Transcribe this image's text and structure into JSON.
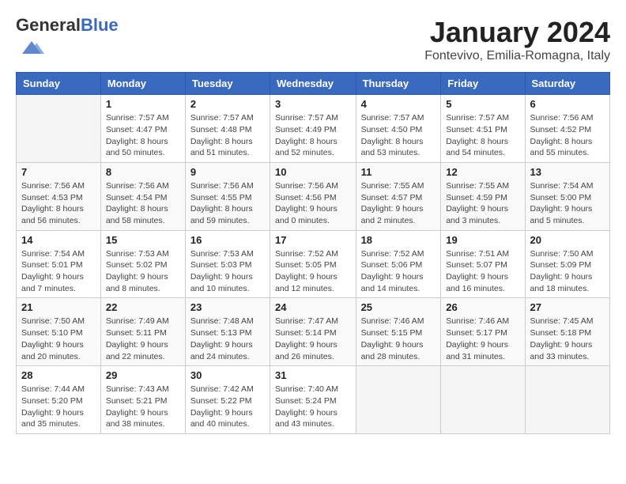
{
  "header": {
    "logo_general": "General",
    "logo_blue": "Blue",
    "month_title": "January 2024",
    "location": "Fontevivo, Emilia-Romagna, Italy"
  },
  "weekdays": [
    "Sunday",
    "Monday",
    "Tuesday",
    "Wednesday",
    "Thursday",
    "Friday",
    "Saturday"
  ],
  "weeks": [
    [
      {
        "day": "",
        "sunrise": "",
        "sunset": "",
        "daylight": ""
      },
      {
        "day": "1",
        "sunrise": "Sunrise: 7:57 AM",
        "sunset": "Sunset: 4:47 PM",
        "daylight": "Daylight: 8 hours and 50 minutes."
      },
      {
        "day": "2",
        "sunrise": "Sunrise: 7:57 AM",
        "sunset": "Sunset: 4:48 PM",
        "daylight": "Daylight: 8 hours and 51 minutes."
      },
      {
        "day": "3",
        "sunrise": "Sunrise: 7:57 AM",
        "sunset": "Sunset: 4:49 PM",
        "daylight": "Daylight: 8 hours and 52 minutes."
      },
      {
        "day": "4",
        "sunrise": "Sunrise: 7:57 AM",
        "sunset": "Sunset: 4:50 PM",
        "daylight": "Daylight: 8 hours and 53 minutes."
      },
      {
        "day": "5",
        "sunrise": "Sunrise: 7:57 AM",
        "sunset": "Sunset: 4:51 PM",
        "daylight": "Daylight: 8 hours and 54 minutes."
      },
      {
        "day": "6",
        "sunrise": "Sunrise: 7:56 AM",
        "sunset": "Sunset: 4:52 PM",
        "daylight": "Daylight: 8 hours and 55 minutes."
      }
    ],
    [
      {
        "day": "7",
        "sunrise": "Sunrise: 7:56 AM",
        "sunset": "Sunset: 4:53 PM",
        "daylight": "Daylight: 8 hours and 56 minutes."
      },
      {
        "day": "8",
        "sunrise": "Sunrise: 7:56 AM",
        "sunset": "Sunset: 4:54 PM",
        "daylight": "Daylight: 8 hours and 58 minutes."
      },
      {
        "day": "9",
        "sunrise": "Sunrise: 7:56 AM",
        "sunset": "Sunset: 4:55 PM",
        "daylight": "Daylight: 8 hours and 59 minutes."
      },
      {
        "day": "10",
        "sunrise": "Sunrise: 7:56 AM",
        "sunset": "Sunset: 4:56 PM",
        "daylight": "Daylight: 9 hours and 0 minutes."
      },
      {
        "day": "11",
        "sunrise": "Sunrise: 7:55 AM",
        "sunset": "Sunset: 4:57 PM",
        "daylight": "Daylight: 9 hours and 2 minutes."
      },
      {
        "day": "12",
        "sunrise": "Sunrise: 7:55 AM",
        "sunset": "Sunset: 4:59 PM",
        "daylight": "Daylight: 9 hours and 3 minutes."
      },
      {
        "day": "13",
        "sunrise": "Sunrise: 7:54 AM",
        "sunset": "Sunset: 5:00 PM",
        "daylight": "Daylight: 9 hours and 5 minutes."
      }
    ],
    [
      {
        "day": "14",
        "sunrise": "Sunrise: 7:54 AM",
        "sunset": "Sunset: 5:01 PM",
        "daylight": "Daylight: 9 hours and 7 minutes."
      },
      {
        "day": "15",
        "sunrise": "Sunrise: 7:53 AM",
        "sunset": "Sunset: 5:02 PM",
        "daylight": "Daylight: 9 hours and 8 minutes."
      },
      {
        "day": "16",
        "sunrise": "Sunrise: 7:53 AM",
        "sunset": "Sunset: 5:03 PM",
        "daylight": "Daylight: 9 hours and 10 minutes."
      },
      {
        "day": "17",
        "sunrise": "Sunrise: 7:52 AM",
        "sunset": "Sunset: 5:05 PM",
        "daylight": "Daylight: 9 hours and 12 minutes."
      },
      {
        "day": "18",
        "sunrise": "Sunrise: 7:52 AM",
        "sunset": "Sunset: 5:06 PM",
        "daylight": "Daylight: 9 hours and 14 minutes."
      },
      {
        "day": "19",
        "sunrise": "Sunrise: 7:51 AM",
        "sunset": "Sunset: 5:07 PM",
        "daylight": "Daylight: 9 hours and 16 minutes."
      },
      {
        "day": "20",
        "sunrise": "Sunrise: 7:50 AM",
        "sunset": "Sunset: 5:09 PM",
        "daylight": "Daylight: 9 hours and 18 minutes."
      }
    ],
    [
      {
        "day": "21",
        "sunrise": "Sunrise: 7:50 AM",
        "sunset": "Sunset: 5:10 PM",
        "daylight": "Daylight: 9 hours and 20 minutes."
      },
      {
        "day": "22",
        "sunrise": "Sunrise: 7:49 AM",
        "sunset": "Sunset: 5:11 PM",
        "daylight": "Daylight: 9 hours and 22 minutes."
      },
      {
        "day": "23",
        "sunrise": "Sunrise: 7:48 AM",
        "sunset": "Sunset: 5:13 PM",
        "daylight": "Daylight: 9 hours and 24 minutes."
      },
      {
        "day": "24",
        "sunrise": "Sunrise: 7:47 AM",
        "sunset": "Sunset: 5:14 PM",
        "daylight": "Daylight: 9 hours and 26 minutes."
      },
      {
        "day": "25",
        "sunrise": "Sunrise: 7:46 AM",
        "sunset": "Sunset: 5:15 PM",
        "daylight": "Daylight: 9 hours and 28 minutes."
      },
      {
        "day": "26",
        "sunrise": "Sunrise: 7:46 AM",
        "sunset": "Sunset: 5:17 PM",
        "daylight": "Daylight: 9 hours and 31 minutes."
      },
      {
        "day": "27",
        "sunrise": "Sunrise: 7:45 AM",
        "sunset": "Sunset: 5:18 PM",
        "daylight": "Daylight: 9 hours and 33 minutes."
      }
    ],
    [
      {
        "day": "28",
        "sunrise": "Sunrise: 7:44 AM",
        "sunset": "Sunset: 5:20 PM",
        "daylight": "Daylight: 9 hours and 35 minutes."
      },
      {
        "day": "29",
        "sunrise": "Sunrise: 7:43 AM",
        "sunset": "Sunset: 5:21 PM",
        "daylight": "Daylight: 9 hours and 38 minutes."
      },
      {
        "day": "30",
        "sunrise": "Sunrise: 7:42 AM",
        "sunset": "Sunset: 5:22 PM",
        "daylight": "Daylight: 9 hours and 40 minutes."
      },
      {
        "day": "31",
        "sunrise": "Sunrise: 7:40 AM",
        "sunset": "Sunset: 5:24 PM",
        "daylight": "Daylight: 9 hours and 43 minutes."
      },
      {
        "day": "",
        "sunrise": "",
        "sunset": "",
        "daylight": ""
      },
      {
        "day": "",
        "sunrise": "",
        "sunset": "",
        "daylight": ""
      },
      {
        "day": "",
        "sunrise": "",
        "sunset": "",
        "daylight": ""
      }
    ]
  ]
}
